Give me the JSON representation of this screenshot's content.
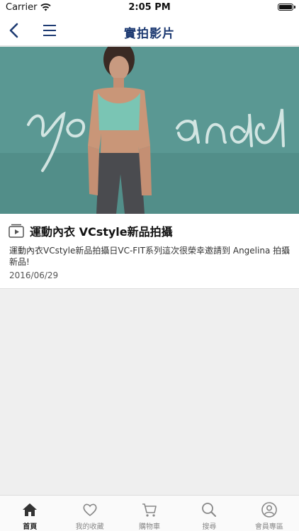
{
  "status_bar": {
    "carrier": "Carrier",
    "time": "2:05 PM"
  },
  "nav": {
    "title": "實拍影片"
  },
  "video_list": [
    {
      "title": "運動內衣 VCstyle新品拍攝",
      "description": "運動內衣VCstyle新品拍攝日VC-FIT系列這次很榮幸邀請到 Angelina 拍攝新品!",
      "date": "2016/06/29",
      "thumbnail_text": "you and"
    }
  ],
  "tabs": [
    {
      "label": "首頁",
      "icon": "home-icon",
      "active": true
    },
    {
      "label": "我的收藏",
      "icon": "heart-icon",
      "active": false
    },
    {
      "label": "購物車",
      "icon": "cart-icon",
      "active": false
    },
    {
      "label": "搜尋",
      "icon": "search-icon",
      "active": false
    },
    {
      "label": "會員專區",
      "icon": "user-icon",
      "active": false
    }
  ],
  "colors": {
    "accent": "#1d3a72",
    "thumb_bg": "#4e8a86"
  }
}
